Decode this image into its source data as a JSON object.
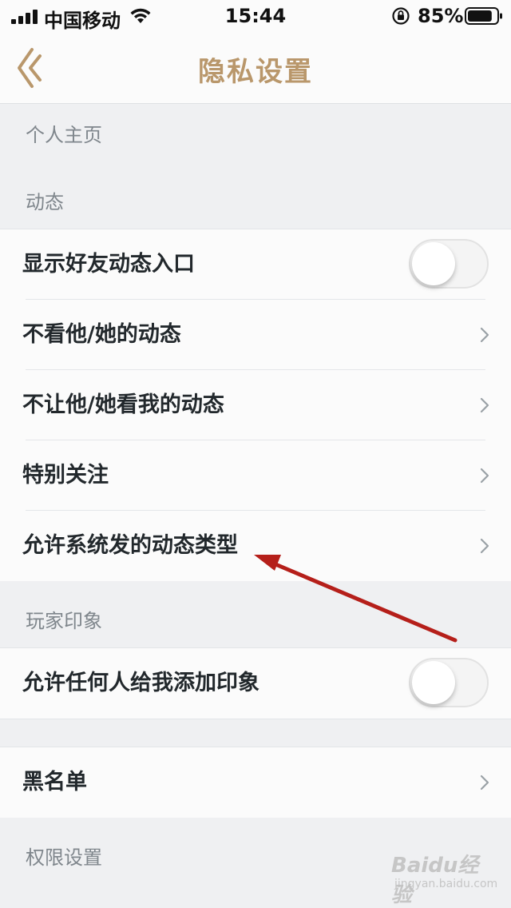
{
  "status_bar": {
    "carrier": "中国移动",
    "time": "15:44",
    "battery_percent": "85%",
    "icons": [
      "signal-icon",
      "wifi-icon",
      "orientation-lock-icon",
      "battery-icon"
    ],
    "battery_level": 0.85
  },
  "nav": {
    "title": "隐私设置",
    "back_icon": "back-chevron-icon",
    "accent_color": "#b9976b"
  },
  "sections": {
    "personal_home": "个人主页",
    "moments": "动态",
    "player_impression": "玩家印象",
    "permissions": "权限设置"
  },
  "moments_rows": [
    {
      "label": "显示好友动态入口",
      "control": "toggle",
      "on": false
    },
    {
      "label": "不看他/她的动态",
      "control": "chevron"
    },
    {
      "label": "不让他/她看我的动态",
      "control": "chevron"
    },
    {
      "label": "特别关注",
      "control": "chevron"
    },
    {
      "label": "允许系统发的动态类型",
      "control": "chevron"
    }
  ],
  "impression_rows": [
    {
      "label": "允许任何人给我添加印象",
      "control": "toggle",
      "on": false
    }
  ],
  "blacklist_row": {
    "label": "黑名单",
    "control": "chevron"
  },
  "watermark": {
    "brand": "Baidu经验",
    "url": "jingyan.baidu.com"
  },
  "annotation": {
    "type": "red-arrow",
    "color": "#b51f1a"
  }
}
